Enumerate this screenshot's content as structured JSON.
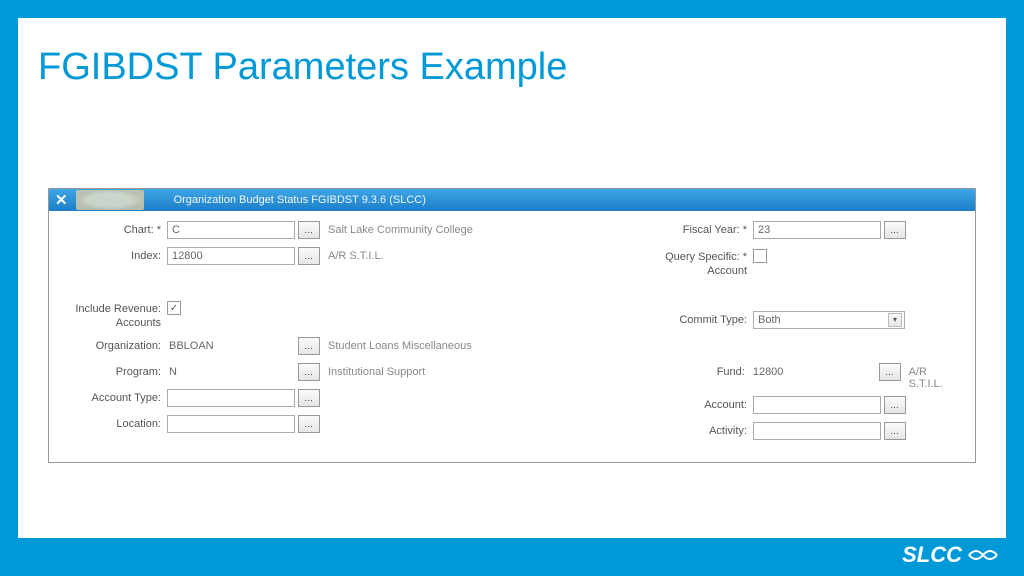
{
  "slide": {
    "title": "FGIBDST Parameters Example"
  },
  "form": {
    "header_title": "Organization Budget Status FGIBDST 9.3.6 (SLCC)",
    "logo_text": "Salt Lake Community College"
  },
  "left": {
    "chart_label": "Chart: *",
    "chart_value": "C",
    "chart_desc": "Salt Lake Community College",
    "index_label": "Index:",
    "index_value": "12800",
    "index_desc": "A/R S.T.I.L.",
    "include_rev_label": "Include Revenue: Accounts",
    "include_rev_label1": "Include Revenue:",
    "include_rev_label2": "Accounts",
    "include_rev_checked": "✓",
    "org_label": "Organization:",
    "org_value": "BBLOAN",
    "org_desc": "Student Loans Miscellaneous",
    "program_label": "Program:",
    "program_value": "N",
    "program_desc": "Institutional Support",
    "acct_type_label": "Account Type:",
    "acct_type_value": "",
    "location_label": "Location:",
    "location_value": ""
  },
  "right": {
    "fy_label": "Fiscal Year: *",
    "fy_value": "23",
    "query_label1": "Query Specific: *",
    "query_label2": "Account",
    "commit_label": "Commit Type:",
    "commit_value": "Both",
    "fund_label": "Fund:",
    "fund_value": "12800",
    "fund_desc": "A/R S.T.I.L.",
    "account_label": "Account:",
    "account_value": "",
    "activity_label": "Activity:",
    "activity_value": ""
  },
  "footer_brand": "SLCC"
}
